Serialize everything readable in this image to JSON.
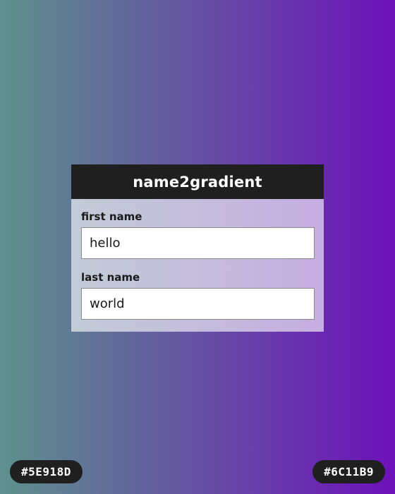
{
  "app": {
    "title": "name2gradient"
  },
  "form": {
    "first_name": {
      "label": "first name",
      "value": "hello"
    },
    "last_name": {
      "label": "last name",
      "value": "world"
    }
  },
  "gradient": {
    "start_color": "#5E918D",
    "end_color": "#6C11B9",
    "start_label": "#5E918D",
    "end_label": "#6C11B9"
  }
}
